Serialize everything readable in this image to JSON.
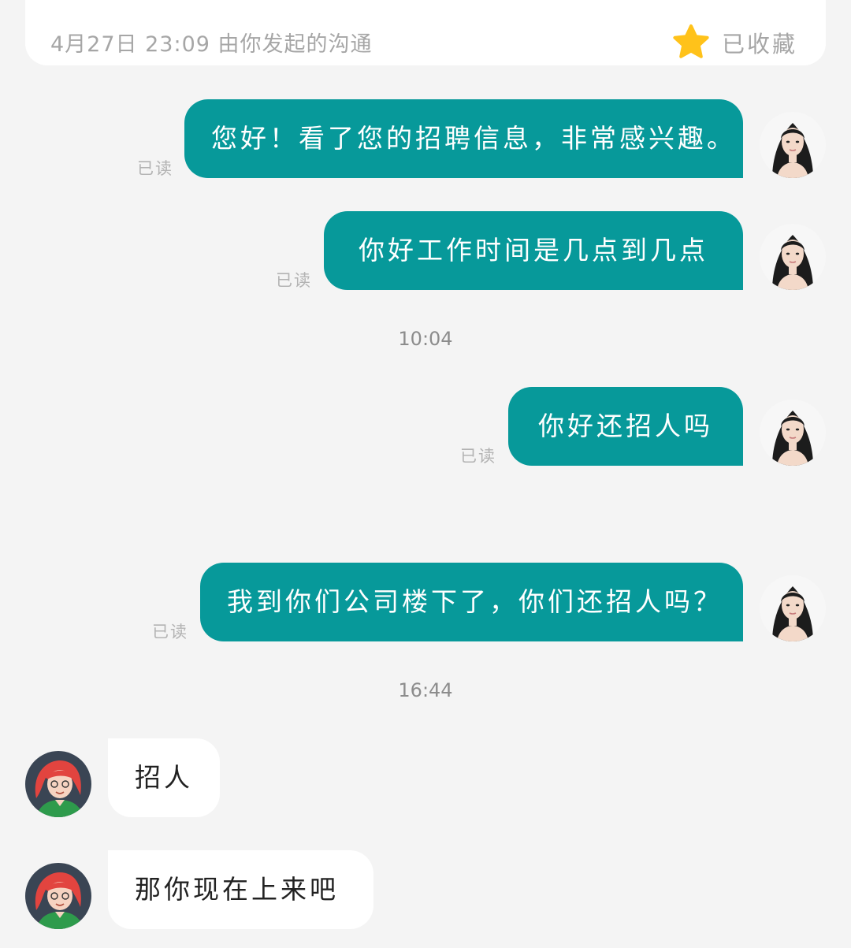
{
  "header": {
    "info": "4月27日 23:09 由你发起的沟通",
    "favorite_label": "已收藏",
    "favorite_icon": "star-icon"
  },
  "colors": {
    "outgoing_bubble": "#07999a",
    "incoming_bubble": "#ffffff",
    "background": "#f4f4f4",
    "star": "#ffc21a"
  },
  "messages": [
    {
      "text": "您好！看了您的招聘信息，非常感兴趣。",
      "status": "已读"
    },
    {
      "text": "你好工作时间是几点到几点",
      "status": "已读"
    },
    {
      "time": "10:04"
    },
    {
      "text": "你好还招人吗",
      "status": "已读"
    },
    {
      "text": "我到你们公司楼下了，你们还招人吗？",
      "status": "已读"
    },
    {
      "time": "16:44"
    },
    {
      "text": "招人"
    },
    {
      "text": "那你现在上来吧"
    }
  ]
}
